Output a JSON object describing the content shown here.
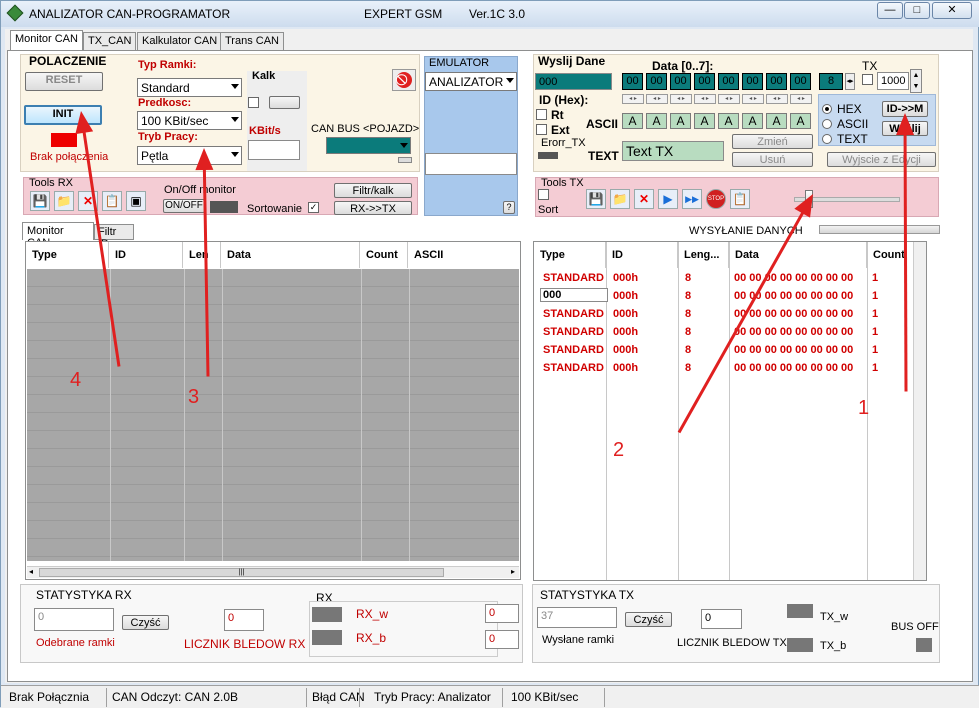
{
  "window": {
    "title": "ANALIZATOR CAN-PROGRAMATOR",
    "title_center": "EXPERT GSM",
    "version": "Ver.1C 3.0",
    "minimize": "—",
    "maximize": "□",
    "close": "✕"
  },
  "tabs": [
    "Monitor CAN",
    "TX_CAN",
    "Kalkulator CAN",
    "Trans CAN"
  ],
  "polaczenie": {
    "title": "POLACZENIE",
    "reset": "RESET",
    "init": "INIT",
    "status": "Brak połączenia"
  },
  "config": {
    "typ_ramki_label": "Typ Ramki:",
    "typ_ramki_value": "Standard",
    "predkosc_label": "Predkosc:",
    "predkosc_value": "100 KBit/sec",
    "tryb_label": "Tryb Pracy:",
    "tryb_value": "Pętla",
    "kalk_label": "Kalk",
    "kbits_label": "KBit/s",
    "can_bus_label": "CAN BUS <POJAZD>"
  },
  "emulator": {
    "title": "EMULATOR",
    "value": "ANALIZATOR",
    "help": "?"
  },
  "wyslij": {
    "title": "Wyslij Dane",
    "data_label": "Data [0..7]:",
    "tx_label": "TX",
    "id_value": "000",
    "hex_bytes": [
      "00",
      "00",
      "00",
      "00",
      "00",
      "00",
      "00",
      "00"
    ],
    "dlc": "8",
    "tx_interval": "1000",
    "id_hex_label": "ID (Hex):",
    "rt_label": "Rt",
    "ext_label": "Ext",
    "error_tx_label": "Erorr_TX",
    "ascii_label": "ASCII",
    "ascii_cells": [
      "A",
      "A",
      "A",
      "A",
      "A",
      "A",
      "A",
      "A"
    ],
    "text_label": "TEXT",
    "text_value": "Text TX",
    "zmien": "Zmień",
    "usun": "Usuń",
    "wyjscie": "Wyjscie z Edycji",
    "hex_radio": "HEX",
    "ascii_radio": "ASCII",
    "text_radio": "TEXT",
    "id_to_m": "ID->>M",
    "wyslij_btn": "Wyślij"
  },
  "tools_rx": {
    "title": "Tools RX",
    "onoff_title": "On/Off monitor",
    "onoff_btn": "ON/OFF",
    "sortowanie": "Sortowanie",
    "filtr_btn": "Filtr/kalk",
    "rx_tx_btn": "RX->>TX"
  },
  "tools_tx": {
    "title": "Tools TX",
    "sort_label": "Sort",
    "wysylanie": "WYSYŁANIE DANYCH"
  },
  "rx_grid": {
    "tabs": [
      "Monitor CAN",
      "Filtr ID"
    ],
    "columns": [
      "Type",
      "ID",
      "Len",
      "Data",
      "Count",
      "ASCII"
    ]
  },
  "tx_grid": {
    "columns": [
      "Type",
      "ID",
      "Leng...",
      "Data",
      "Count"
    ],
    "rows": [
      {
        "type": "STANDARD",
        "id": "000h",
        "len": "8",
        "data": "00 00 00 00 00 00 00 00",
        "count": "1"
      },
      {
        "type": "000",
        "id": "000h",
        "len": "8",
        "data": "00 00 00 00 00 00 00 00",
        "count": "1"
      },
      {
        "type": "STANDARD",
        "id": "000h",
        "len": "8",
        "data": "00 00 00 00 00 00 00 00",
        "count": "1"
      },
      {
        "type": "STANDARD",
        "id": "000h",
        "len": "8",
        "data": "00 00 00 00 00 00 00 00",
        "count": "1"
      },
      {
        "type": "STANDARD",
        "id": "000h",
        "len": "8",
        "data": "00 00 00 00 00 00 00 00",
        "count": "1"
      },
      {
        "type": "STANDARD",
        "id": "000h",
        "len": "8",
        "data": "00 00 00 00 00 00 00 00",
        "count": "1"
      }
    ]
  },
  "stat_rx": {
    "title": "STATYSTYKA RX",
    "input": "0",
    "czysc": "Czyść",
    "counter": "0",
    "odebrane": "Odebrane ramki",
    "licznik": "LICZNIK BLEDOW RX",
    "rx_label": "RX",
    "rx_w": "RX_w",
    "rx_b": "RX_b",
    "rx_w_val": "0",
    "rx_b_val": "0"
  },
  "stat_tx": {
    "title": "STATYSTYKA TX",
    "input": "37",
    "czysc": "Czyść",
    "counter": "0",
    "wyslane": "Wysłane ramki",
    "licznik": "LICZNIK BLEDOW TX",
    "tx_w": "TX_w",
    "tx_b": "TX_b",
    "bus_off": "BUS OFF"
  },
  "statusbar": {
    "conn": "Brak Połącznia",
    "can": "CAN Odczyt: CAN 2.0B",
    "err": "Błąd CAN",
    "mode": "Tryb Pracy: Analizator",
    "speed": "100 KBit/sec"
  },
  "annotations": [
    "1",
    "2",
    "3",
    "4"
  ],
  "colors": {
    "arrow": "#e02020",
    "hex_cell": "#0b7b7b",
    "error_red": "#c00000"
  }
}
